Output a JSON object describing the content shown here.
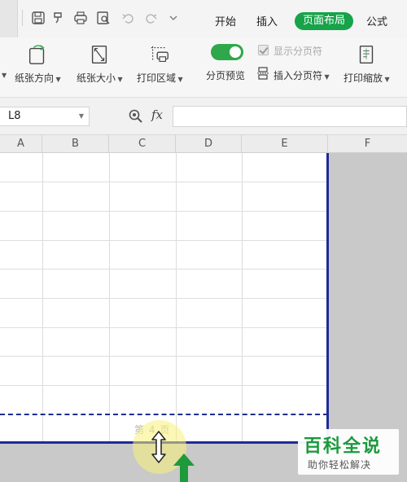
{
  "ribbon_tabs": {
    "start": "开始",
    "insert": "插入",
    "page_layout": "页面布局",
    "formula": "公式"
  },
  "ribbon": {
    "orientation_label": "纸张方向",
    "size_label": "纸张大小",
    "print_area_label": "打印区域",
    "page_break_preview_label": "分页预览",
    "show_page_breaks_label": "显示分页符",
    "insert_page_break_label": "插入分页符",
    "print_scaling_label": "打印缩放",
    "page_break_preview_on": true,
    "show_page_breaks_checked": true
  },
  "formula_bar": {
    "cell_reference": "L8",
    "fx_symbol": "fx",
    "formula_value": ""
  },
  "columns": [
    "A",
    "B",
    "C",
    "D",
    "E",
    "F"
  ],
  "sheet": {
    "page_label": "第 4 页"
  },
  "watermark": {
    "title": "百科全说",
    "subtitle": "助你轻松解决"
  },
  "colors": {
    "accent_green": "#17a34a",
    "page_break_blue": "#1f2a9a",
    "arrow_green": "#1e9a3a"
  }
}
